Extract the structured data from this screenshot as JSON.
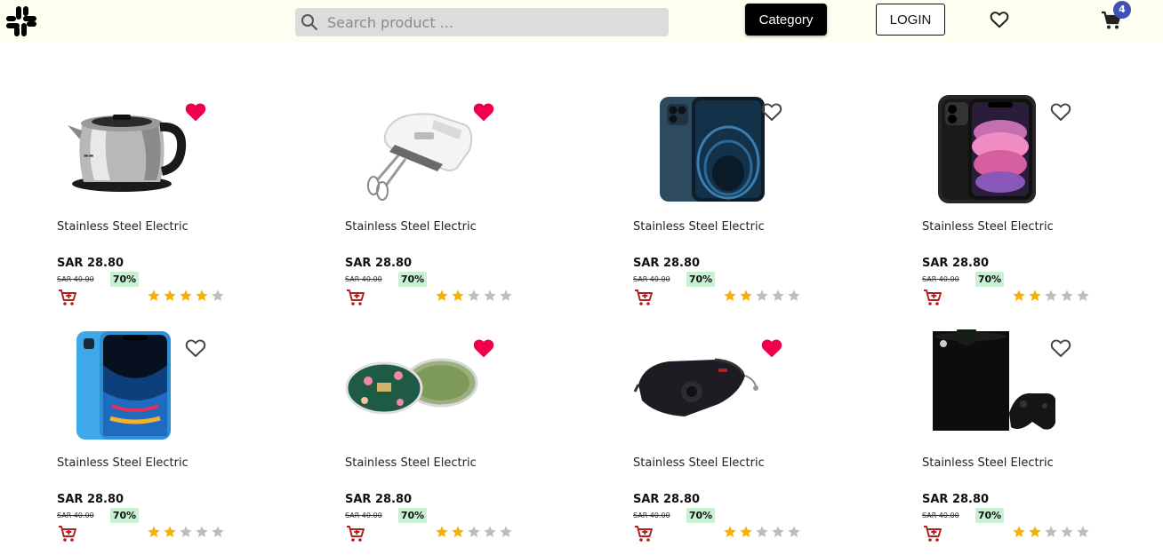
{
  "header": {
    "logo_name": "slack-logo",
    "search_placeholder": "Search product ...",
    "category_label": "Category",
    "login_label": "LOGIN",
    "cart_count": "4"
  },
  "colors": {
    "accent_heart": "#f0004a",
    "star_filled": "#f6b000",
    "star_empty": "#bdbdbd",
    "cart_icon": "#b22020",
    "discount_bg": "#c8f0d2",
    "badge_bg": "#3f51b5"
  },
  "products": [
    {
      "name": "Stainless Steel Electric",
      "price": "SAR 28.80",
      "old_price": "SAR 40.00",
      "discount": "70%",
      "rating": 4,
      "favorite": true,
      "image": "kettle"
    },
    {
      "name": "Stainless Steel Electric",
      "price": "SAR 28.80",
      "old_price": "SAR 40.00",
      "discount": "70%",
      "rating": 2,
      "favorite": true,
      "image": "hand-mixer"
    },
    {
      "name": "Stainless Steel Electric",
      "price": "SAR 28.80",
      "old_price": "SAR 40.00",
      "discount": "70%",
      "rating": 2,
      "favorite": false,
      "image": "iphone-12-pro"
    },
    {
      "name": "Stainless Steel Electric",
      "price": "SAR 28.80",
      "old_price": "SAR 40.00",
      "discount": "70%",
      "rating": 2,
      "favorite": false,
      "image": "iphone-11"
    },
    {
      "name": "Stainless Steel Electric",
      "price": "SAR 28.80",
      "old_price": "SAR 40.00",
      "discount": "70%",
      "rating": 2,
      "favorite": false,
      "image": "iphone-xr"
    },
    {
      "name": "Stainless Steel Electric",
      "price": "SAR 28.80",
      "old_price": "SAR 40.00",
      "discount": "70%",
      "rating": 2,
      "favorite": true,
      "image": "eye-gel-patches"
    },
    {
      "name": "Stainless Steel Electric",
      "price": "SAR 28.80",
      "old_price": "SAR 40.00",
      "discount": "70%",
      "rating": 2,
      "favorite": true,
      "image": "face-mask"
    },
    {
      "name": "Stainless Steel Electric",
      "price": "SAR 28.80",
      "old_price": "SAR 40.00",
      "discount": "70%",
      "rating": 2,
      "favorite": false,
      "image": "xbox-series-x"
    }
  ]
}
